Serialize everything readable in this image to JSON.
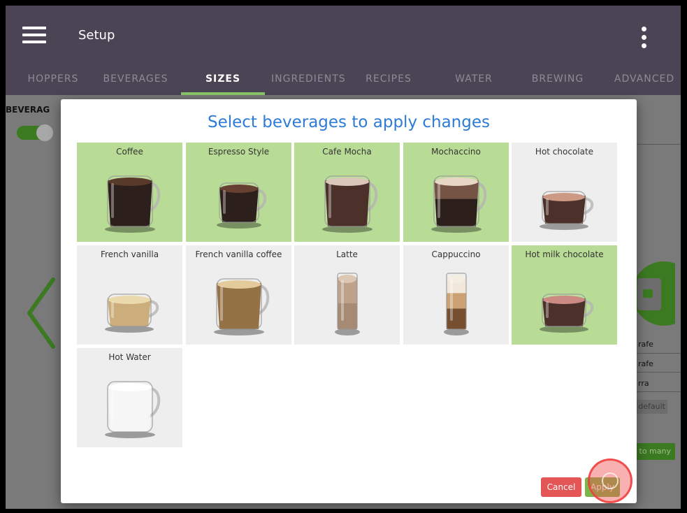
{
  "appbar": {
    "title": "Setup",
    "tabs": [
      {
        "label": "HOPPERS",
        "active": false
      },
      {
        "label": "BEVERAGES",
        "active": false
      },
      {
        "label": "SIZES",
        "active": true
      },
      {
        "label": "INGREDIENTS",
        "active": false
      },
      {
        "label": "RECIPES",
        "active": false
      },
      {
        "label": "WATER",
        "active": false
      },
      {
        "label": "BREWING",
        "active": false
      },
      {
        "label": "ADVANCED",
        "active": false
      }
    ]
  },
  "background": {
    "section_label": "BEVERAG",
    "rows": [
      "rafe",
      "rafe",
      "rra"
    ],
    "default_chip": "default",
    "many_button": "to many"
  },
  "dialog": {
    "title": "Select beverages to apply changes",
    "cancel_label": "Cancel",
    "apply_label": "Apply",
    "beverages": [
      {
        "name": "Coffee",
        "selected": true,
        "drink": "coffee"
      },
      {
        "name": "Espresso Style",
        "selected": true,
        "drink": "espresso"
      },
      {
        "name": "Cafe Mocha",
        "selected": true,
        "drink": "mocha"
      },
      {
        "name": "Mochaccino",
        "selected": true,
        "drink": "mochaccino"
      },
      {
        "name": "Hot chocolate",
        "selected": false,
        "drink": "hot-chocolate"
      },
      {
        "name": "French vanilla",
        "selected": false,
        "drink": "vanilla"
      },
      {
        "name": "French vanilla coffee",
        "selected": false,
        "drink": "vanilla-coffee"
      },
      {
        "name": "Latte",
        "selected": false,
        "drink": "latte"
      },
      {
        "name": "Cappuccino",
        "selected": false,
        "drink": "cappuccino"
      },
      {
        "name": "Hot milk chocolate",
        "selected": true,
        "drink": "hot-milk-chocolate"
      },
      {
        "name": "Hot Water",
        "selected": false,
        "drink": "water"
      }
    ]
  },
  "colors": {
    "appbar": "#4b4454",
    "tab_indicator": "#8dc96b",
    "selected_tile": "#b8dc95",
    "unselected_tile": "#eeeeee",
    "title_blue": "#2e7bd6",
    "cancel_red": "#e45555",
    "apply_green": "#7ab648"
  }
}
